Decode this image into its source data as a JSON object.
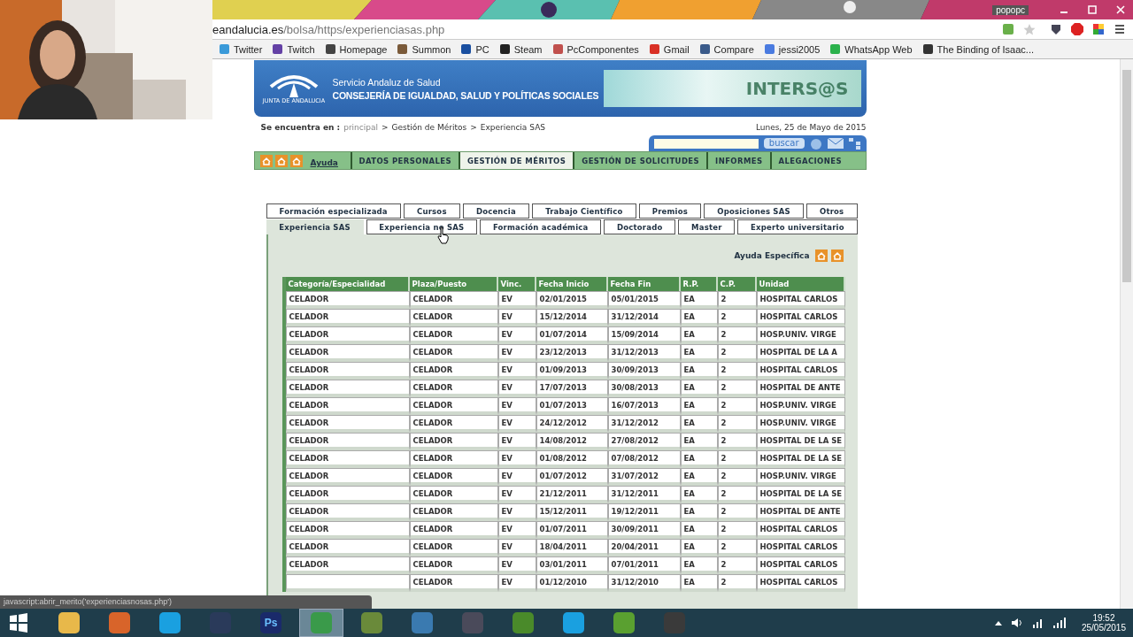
{
  "browser": {
    "window_user": "popopc",
    "address": {
      "host": "eandalucia.es",
      "path": "/bolsa/https/experienciasas.php"
    },
    "bookmarks": [
      {
        "label": "Twitter",
        "color": "#3a9ad9"
      },
      {
        "label": "Twitch",
        "color": "#6441a5"
      },
      {
        "label": "Homepage",
        "color": "#444444"
      },
      {
        "label": "Summon",
        "color": "#7a5a3a"
      },
      {
        "label": "PC",
        "color": "#1a4fa0"
      },
      {
        "label": "Steam",
        "color": "#222222"
      },
      {
        "label": "PcComponentes",
        "color": "#c0504d"
      },
      {
        "label": "Gmail",
        "color": "#d93025"
      },
      {
        "label": "Compare",
        "color": "#3a5a8a"
      },
      {
        "label": "jessi2005",
        "color": "#4a7be0"
      },
      {
        "label": "WhatsApp Web",
        "color": "#2bb24c"
      },
      {
        "label": "The Binding of Isaac...",
        "color": "#333333"
      }
    ]
  },
  "header": {
    "logo_caption": "JUNTA DE ANDALUCIA",
    "org": "Servicio Andaluz de Salud",
    "ministry": "CONSEJERÍA DE IGUALDAD, SALUD Y POLÍTICAS SOCIALES",
    "banner": "INTERS@S"
  },
  "breadcrumb": {
    "label": "Se encuentra en :",
    "separator": ">",
    "items": [
      {
        "text": "principal",
        "link": true
      },
      {
        "text": "Gestión de Méritos",
        "link": false
      },
      {
        "text": "Experiencia SAS",
        "link": false
      }
    ]
  },
  "date": "Lunes, 25 de Mayo de 2015",
  "search": {
    "button": "buscar"
  },
  "nav": {
    "help": "Ayuda",
    "items": [
      {
        "label": "DATOS PERSONALES",
        "selected": false
      },
      {
        "label": "GESTIÓN DE MÉRITOS",
        "selected": true
      },
      {
        "label": "GESTIÓN DE SOLICITUDES",
        "selected": false
      },
      {
        "label": "INFORMES",
        "selected": false
      },
      {
        "label": "ALEGACIONES",
        "selected": false
      }
    ]
  },
  "merit_tabs": [
    [
      {
        "label": "Formación especializada",
        "selected": false
      },
      {
        "label": "Cursos",
        "selected": false
      },
      {
        "label": "Docencia",
        "selected": false
      },
      {
        "label": "Trabajo Científico",
        "selected": false
      },
      {
        "label": "Premios",
        "selected": false
      },
      {
        "label": "Oposiciones SAS",
        "selected": false
      },
      {
        "label": "Otros",
        "selected": false
      }
    ],
    [
      {
        "label": "Experiencia SAS",
        "selected": true
      },
      {
        "label": "Experiencia no SAS",
        "selected": false
      },
      {
        "label": "Formación académica",
        "selected": false
      },
      {
        "label": "Doctorado",
        "selected": false
      },
      {
        "label": "Master",
        "selected": false
      },
      {
        "label": "Experto universitario",
        "selected": false
      }
    ]
  ],
  "specific_help": "Ayuda Específica",
  "table": {
    "columns": [
      "Categoría/Especialidad",
      "Plaza/Puesto",
      "Vinc.",
      "Fecha Inicio",
      "Fecha Fin",
      "R.P.",
      "C.P.",
      "Unidad"
    ],
    "rows": [
      [
        "CELADOR",
        "CELADOR",
        "EV",
        "02/01/2015",
        "05/01/2015",
        "EA",
        "2",
        "HOSPITAL CARLOS"
      ],
      [
        "CELADOR",
        "CELADOR",
        "EV",
        "15/12/2014",
        "31/12/2014",
        "EA",
        "2",
        "HOSPITAL CARLOS"
      ],
      [
        "CELADOR",
        "CELADOR",
        "EV",
        "01/07/2014",
        "15/09/2014",
        "EA",
        "2",
        "HOSP.UNIV. VIRGE"
      ],
      [
        "CELADOR",
        "CELADOR",
        "EV",
        "23/12/2013",
        "31/12/2013",
        "EA",
        "2",
        "HOSPITAL DE LA A"
      ],
      [
        "CELADOR",
        "CELADOR",
        "EV",
        "01/09/2013",
        "30/09/2013",
        "EA",
        "2",
        "HOSPITAL CARLOS"
      ],
      [
        "CELADOR",
        "CELADOR",
        "EV",
        "17/07/2013",
        "30/08/2013",
        "EA",
        "2",
        "HOSPITAL DE ANTE"
      ],
      [
        "CELADOR",
        "CELADOR",
        "EV",
        "01/07/2013",
        "16/07/2013",
        "EA",
        "2",
        "HOSP.UNIV. VIRGE"
      ],
      [
        "CELADOR",
        "CELADOR",
        "EV",
        "24/12/2012",
        "31/12/2012",
        "EA",
        "2",
        "HOSP.UNIV. VIRGE"
      ],
      [
        "CELADOR",
        "CELADOR",
        "EV",
        "14/08/2012",
        "27/08/2012",
        "EA",
        "2",
        "HOSPITAL DE LA SE"
      ],
      [
        "CELADOR",
        "CELADOR",
        "EV",
        "01/08/2012",
        "07/08/2012",
        "EA",
        "2",
        "HOSPITAL DE LA SE"
      ],
      [
        "CELADOR",
        "CELADOR",
        "EV",
        "01/07/2012",
        "31/07/2012",
        "EA",
        "2",
        "HOSP.UNIV. VIRGE"
      ],
      [
        "CELADOR",
        "CELADOR",
        "EV",
        "21/12/2011",
        "31/12/2011",
        "EA",
        "2",
        "HOSPITAL DE LA SE"
      ],
      [
        "CELADOR",
        "CELADOR",
        "EV",
        "15/12/2011",
        "19/12/2011",
        "EA",
        "2",
        "HOSPITAL DE ANTE"
      ],
      [
        "CELADOR",
        "CELADOR",
        "EV",
        "01/07/2011",
        "30/09/2011",
        "EA",
        "2",
        "HOSPITAL CARLOS"
      ],
      [
        "CELADOR",
        "CELADOR",
        "EV",
        "18/04/2011",
        "20/04/2011",
        "EA",
        "2",
        "HOSPITAL CARLOS"
      ],
      [
        "CELADOR",
        "CELADOR",
        "EV",
        "03/01/2011",
        "07/01/2011",
        "EA",
        "2",
        "HOSPITAL CARLOS"
      ],
      [
        "",
        "CELADOR",
        "EV",
        "01/12/2010",
        "31/12/2010",
        "EA",
        "2",
        "HOSPITAL CARLOS"
      ]
    ]
  },
  "status_text": "javascript:abrir_merito('experienciasnosas.php')",
  "taskbar": {
    "apps": [
      {
        "color": "#e8b84a",
        "selected": false
      },
      {
        "color": "#d8642a",
        "selected": false
      },
      {
        "color": "#1aa0e0",
        "selected": false
      },
      {
        "color": "#2a3a5a",
        "selected": false
      },
      {
        "color": "#1a2a6a",
        "label": "Ps",
        "selected": false
      },
      {
        "color": "#3a9a4a",
        "selected": true
      },
      {
        "color": "#6a8a3a",
        "selected": false
      },
      {
        "color": "#3a7ab0",
        "selected": false
      },
      {
        "color": "#4a4a5a",
        "selected": false
      },
      {
        "color": "#4a8a2a",
        "selected": false
      },
      {
        "color": "#1aa0e0",
        "selected": false
      },
      {
        "color": "#5aa030",
        "selected": false
      },
      {
        "color": "#3a3a3a",
        "selected": false
      }
    ],
    "time": "19:52",
    "date": "25/05/2015"
  }
}
